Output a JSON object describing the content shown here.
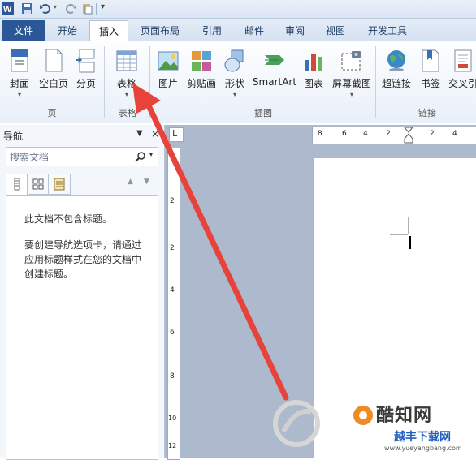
{
  "qat": {
    "app_icon": "word-icon",
    "icons": [
      "save-icon",
      "undo-icon",
      "redo-icon",
      "paste-format-icon",
      "customize-icon"
    ]
  },
  "tabs": [
    {
      "label": "文件",
      "kind": "file"
    },
    {
      "label": "开始"
    },
    {
      "label": "插入",
      "active": true
    },
    {
      "label": "页面布局"
    },
    {
      "label": "引用"
    },
    {
      "label": "邮件"
    },
    {
      "label": "审阅"
    },
    {
      "label": "视图"
    },
    {
      "label": "开发工具"
    }
  ],
  "ribbon": {
    "buttons": {
      "cover": "封面",
      "blank": "空白页",
      "pagebreak": "分页",
      "table": "表格",
      "picture": "图片",
      "clipart": "剪贴画",
      "shapes": "形状",
      "smartart": "SmartArt",
      "chart": "图表",
      "screenshot": "屏幕截图",
      "hyperlink": "超链接",
      "bookmark": "书签",
      "crossref": "交叉引"
    },
    "groups": {
      "pages": "页",
      "tables": "表格",
      "illustrations": "插图",
      "links": "链接"
    }
  },
  "nav": {
    "title": "导航",
    "search_placeholder": "搜索文档",
    "line1": "此文档不包含标题。",
    "line2": "要创建导航选项卡，请通过",
    "line3": "应用标题样式在您的文档中",
    "line4": "创建标题。"
  },
  "ruler": {
    "ticks": [
      "8",
      "6",
      "4",
      "2",
      "2",
      "4"
    ]
  },
  "vruler": {
    "ticks": [
      "2",
      "2",
      "4",
      "6",
      "8",
      "10",
      "12"
    ]
  },
  "colors": {
    "arrow": "#e8433b",
    "file_tab": "#2b5797",
    "workspace": "#adb9cc"
  },
  "watermark": {
    "brand": "酷知网",
    "site": "www.yueyangbang.com",
    "tag": "越丰下载网"
  }
}
